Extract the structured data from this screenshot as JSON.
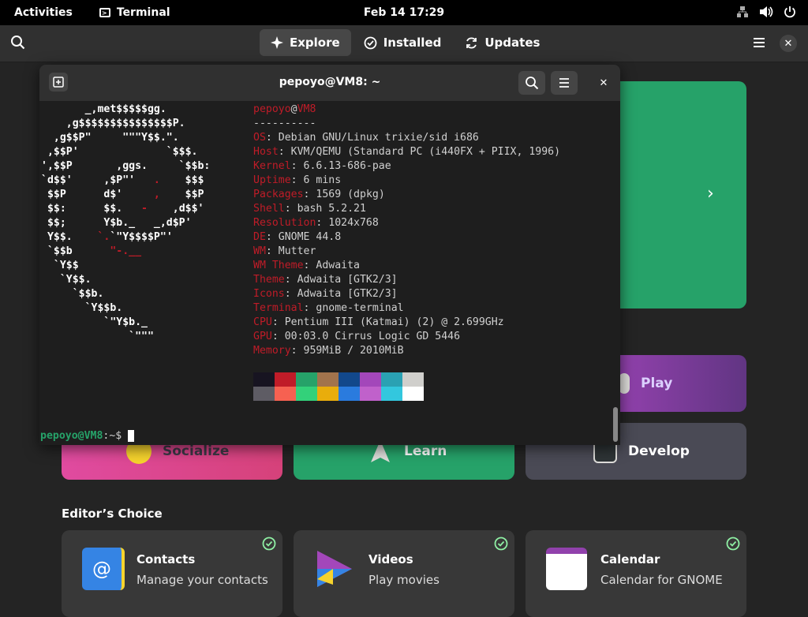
{
  "topbar": {
    "activities": "Activities",
    "app_name": "Terminal",
    "clock": "Feb 14  17:29"
  },
  "header": {
    "tabs": [
      {
        "label": "Explore",
        "icon": "sparkle-icon"
      },
      {
        "label": "Installed",
        "icon": "check-icon"
      },
      {
        "label": "Updates",
        "icon": "refresh-icon"
      }
    ]
  },
  "categories": {
    "play": "Play",
    "socialize": "Socialize",
    "learn": "Learn",
    "develop": "Develop"
  },
  "editors_choice": {
    "title": "Editor’s Choice",
    "cards": [
      {
        "title": "Contacts",
        "subtitle": "Manage your contacts"
      },
      {
        "title": "Videos",
        "subtitle": "Play movies"
      },
      {
        "title": "Calendar",
        "subtitle": "Calendar for GNOME"
      }
    ]
  },
  "terminal": {
    "title": "pepoyo@VM8: ~",
    "user": "pepoyo",
    "host": "VM8",
    "separator": "----------",
    "info": [
      {
        "key": "OS",
        "value": "Debian GNU/Linux trixie/sid i686"
      },
      {
        "key": "Host",
        "value": "KVM/QEMU (Standard PC (i440FX + PIIX, 1996)"
      },
      {
        "key": "Kernel",
        "value": "6.6.13-686-pae"
      },
      {
        "key": "Uptime",
        "value": "6 mins"
      },
      {
        "key": "Packages",
        "value": "1569 (dpkg)"
      },
      {
        "key": "Shell",
        "value": "bash 5.2.21"
      },
      {
        "key": "Resolution",
        "value": "1024x768"
      },
      {
        "key": "DE",
        "value": "GNOME 44.8"
      },
      {
        "key": "WM",
        "value": "Mutter"
      },
      {
        "key": "WM Theme",
        "value": "Adwaita"
      },
      {
        "key": "Theme",
        "value": "Adwaita [GTK2/3]"
      },
      {
        "key": "Icons",
        "value": "Adwaita [GTK2/3]"
      },
      {
        "key": "Terminal",
        "value": "gnome-terminal"
      },
      {
        "key": "CPU",
        "value": "Pentium III (Katmai) (2) @ 2.699GHz"
      },
      {
        "key": "GPU",
        "value": "00:03.0 Cirrus Logic GD 5446"
      },
      {
        "key": "Memory",
        "value": "959MiB / 2010MiB"
      }
    ],
    "palette": [
      "#171421",
      "#c01c28",
      "#26a269",
      "#a2734c",
      "#12488b",
      "#a347ba",
      "#2aa1b3",
      "#d0cfcc",
      "#5e5c64",
      "#f66151",
      "#33d17a",
      "#e9ad0c",
      "#2a7bde",
      "#c061cb",
      "#33c7de",
      "#ffffff"
    ],
    "prompt_user": "pepoyo@VM8",
    "prompt_rest": ":~$ "
  }
}
